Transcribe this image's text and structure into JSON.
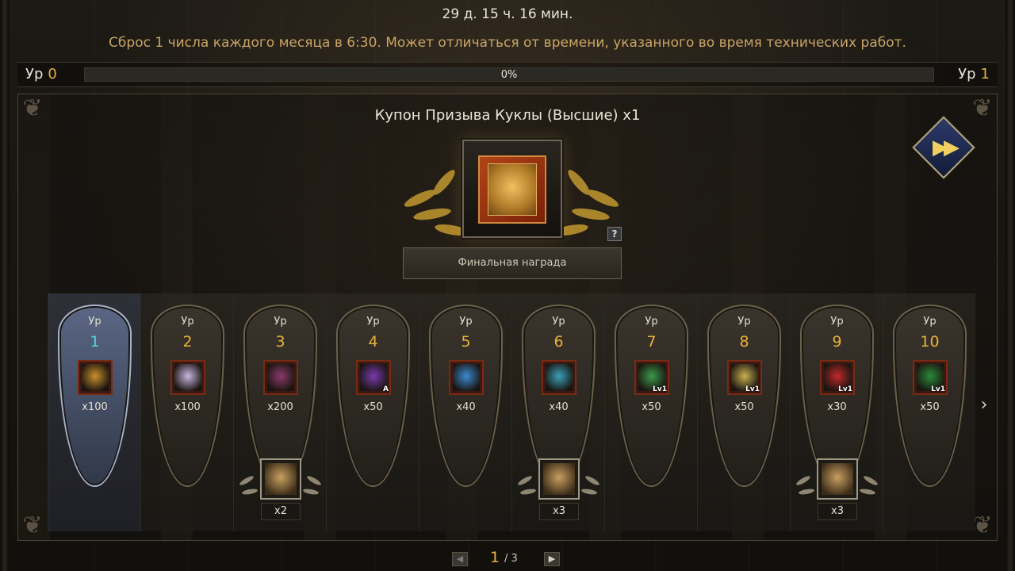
{
  "header": {
    "timer": "29 д. 15 ч. 16 мин.",
    "reset_note": "Сброс 1 числа каждого месяца в 6:30. Может отличаться от времени, указанного во время технических работ."
  },
  "level_bar": {
    "left_label": "Ур",
    "left_value": "0",
    "right_label": "Ур",
    "right_value": "1",
    "progress_text": "0%",
    "progress_fraction": 0
  },
  "final_reward": {
    "title": "Купон Призыва Куклы (Высшие) x1",
    "button_label": "Финальная награда",
    "help_label": "?",
    "skip_icon": "fast-forward-icon"
  },
  "levels": [
    {
      "caption": "Ур",
      "num": "1",
      "qty": "x100",
      "icon": "gold-pile-icon",
      "color": "#c9902a",
      "active": true
    },
    {
      "caption": "Ур",
      "num": "2",
      "qty": "x100",
      "icon": "crystal-box-icon",
      "color": "#c9b7e0"
    },
    {
      "caption": "Ур",
      "num": "3",
      "qty": "x200",
      "icon": "treasure-chest-icon",
      "color": "#8a3a6a",
      "bonus_qty": "x2",
      "bonus_icon": "doll-coupon-green-icon"
    },
    {
      "caption": "Ур",
      "num": "4",
      "qty": "x50",
      "icon": "scroll-a-icon",
      "color": "#7a3ab0",
      "tag": "A"
    },
    {
      "caption": "Ур",
      "num": "5",
      "qty": "x40",
      "icon": "blue-scroll-icon",
      "color": "#3a8ad0"
    },
    {
      "caption": "Ур",
      "num": "6",
      "qty": "x40",
      "icon": "cyan-scroll-icon",
      "color": "#3aa0b8",
      "bonus_qty": "x3",
      "bonus_icon": "doll-coupon-orange-icon"
    },
    {
      "caption": "Ур",
      "num": "7",
      "qty": "x50",
      "icon": "green-rune-icon",
      "color": "#3a9a4a",
      "tag": "Lv1"
    },
    {
      "caption": "Ур",
      "num": "8",
      "qty": "x50",
      "icon": "yellow-rune-icon",
      "color": "#c8b050",
      "tag": "Lv1"
    },
    {
      "caption": "Ур",
      "num": "9",
      "qty": "x30",
      "icon": "red-rune-icon",
      "color": "#c02a2a",
      "tag": "Lv1",
      "bonus_qty": "x3",
      "bonus_icon": "statue-icon"
    },
    {
      "caption": "Ур",
      "num": "10",
      "qty": "x50",
      "icon": "green-aura-icon",
      "color": "#2a8a3a",
      "tag": "Lv1"
    }
  ],
  "pager": {
    "current": "1",
    "total": "/ 3"
  }
}
